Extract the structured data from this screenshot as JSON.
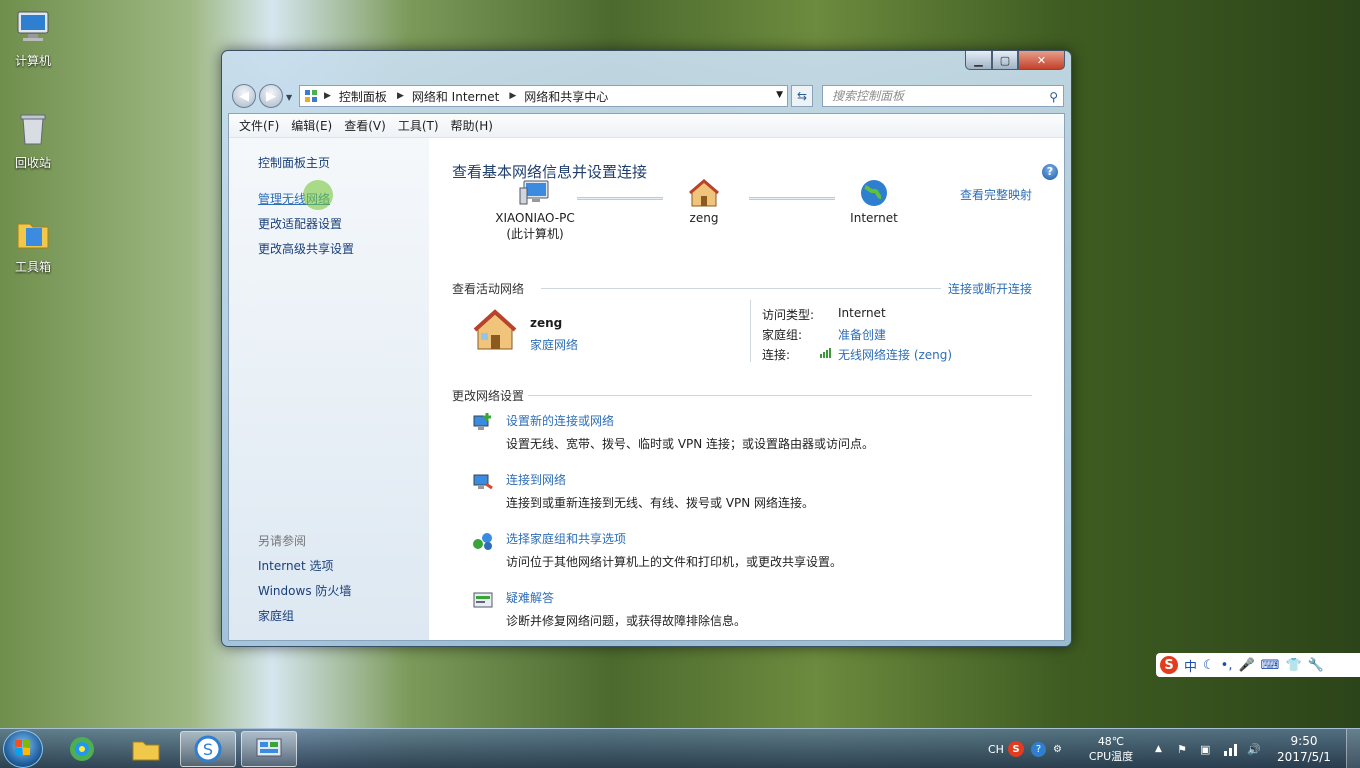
{
  "desktop": {
    "icons": [
      {
        "label": "计算机"
      },
      {
        "label": "回收站"
      },
      {
        "label": "工具箱"
      }
    ]
  },
  "window": {
    "address": {
      "crumbs": [
        "控制面板",
        "网络和 Internet",
        "网络和共享中心"
      ]
    },
    "search_placeholder": "搜索控制面板",
    "menu": [
      "文件(F)",
      "编辑(E)",
      "查看(V)",
      "工具(T)",
      "帮助(H)"
    ],
    "sidebar": {
      "home": "控制面板主页",
      "links": [
        "管理无线网络",
        "更改适配器设置",
        "更改高级共享设置"
      ],
      "see_also_header": "另请参阅",
      "see_also": [
        "Internet 选项",
        "Windows 防火墙",
        "家庭组"
      ]
    },
    "main": {
      "title": "查看基本网络信息并设置连接",
      "full_map_link": "查看完整映射",
      "nodes": [
        {
          "name": "XIAONIAO-PC",
          "sub": "(此计算机)"
        },
        {
          "name": "zeng",
          "sub": ""
        },
        {
          "name": "Internet",
          "sub": ""
        }
      ],
      "active_header": "查看活动网络",
      "connect_link": "连接或断开连接",
      "active": {
        "name": "zeng",
        "type_link": "家庭网络",
        "access_label": "访问类型:",
        "access_value": "Internet",
        "homegroup_label": "家庭组:",
        "homegroup_value": "准备创建",
        "conn_label": "连接:",
        "conn_value": "无线网络连接 (zeng)"
      },
      "change_header": "更改网络设置",
      "tasks": [
        {
          "title": "设置新的连接或网络",
          "desc": "设置无线、宽带、拨号、临时或 VPN 连接；或设置路由器或访问点。"
        },
        {
          "title": "连接到网络",
          "desc": "连接到或重新连接到无线、有线、拨号或 VPN 网络连接。"
        },
        {
          "title": "选择家庭组和共享选项",
          "desc": "访问位于其他网络计算机上的文件和打印机，或更改共享设置。"
        },
        {
          "title": "疑难解答",
          "desc": "诊断并修复网络问题，或获得故障排除信息。"
        }
      ]
    }
  },
  "ime": {
    "label": "中"
  },
  "taskbar": {
    "lang": "CH",
    "temp": "48℃",
    "temp_label": "CPU温度",
    "time": "9:50",
    "date": "2017/5/1"
  }
}
